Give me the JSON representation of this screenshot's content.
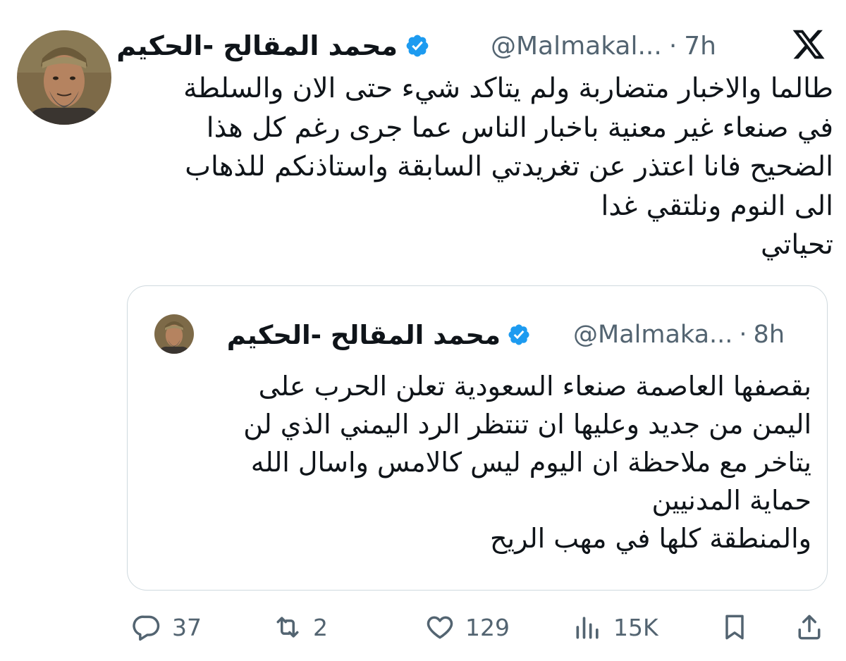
{
  "tweet": {
    "display_name": "محمد المقالح -الحكيم",
    "handle": "@Malmakal...",
    "separator": "·",
    "time": "7h",
    "text": "طالما والاخبار متضاربة  ولم يتاكد شيء حتى الان والسلطة\nفي صنعاء غير معنية باخبار الناس عما جرى رغم كل هذا\nالضحيح فانا اعتذر عن تغريدتي السابقة واستاذنكم للذهاب\nالى  النوم ونلتقي غدا\nتحياتي"
  },
  "quoted_tweet": {
    "display_name": "محمد المقالح -الحكيم",
    "handle": "@Malmaka...",
    "separator": "·",
    "time": "8h",
    "text": "بقصفها العاصمة صنعاء السعودية تعلن الحرب على\nاليمن من جديد وعليها ان تنتظر الرد اليمني الذي لن\nيتاخر مع ملاحظة ان اليوم ليس كالامس واسال الله\nحماية المدنيين\nوالمنطقة كلها في مهب الريح"
  },
  "actions": {
    "replies": "37",
    "reposts": "2",
    "likes": "129",
    "views": "15K"
  },
  "icons": {
    "logo": "x-logo-icon",
    "verified": "verified-badge-icon",
    "reply": "reply-icon",
    "repost": "repost-icon",
    "like": "heart-icon",
    "views": "views-icon",
    "bookmark": "bookmark-icon",
    "share": "share-icon"
  },
  "colors": {
    "verified": "#1d9bf0",
    "text": "#0f1419",
    "secondary": "#536471",
    "border": "#cfd9de"
  }
}
